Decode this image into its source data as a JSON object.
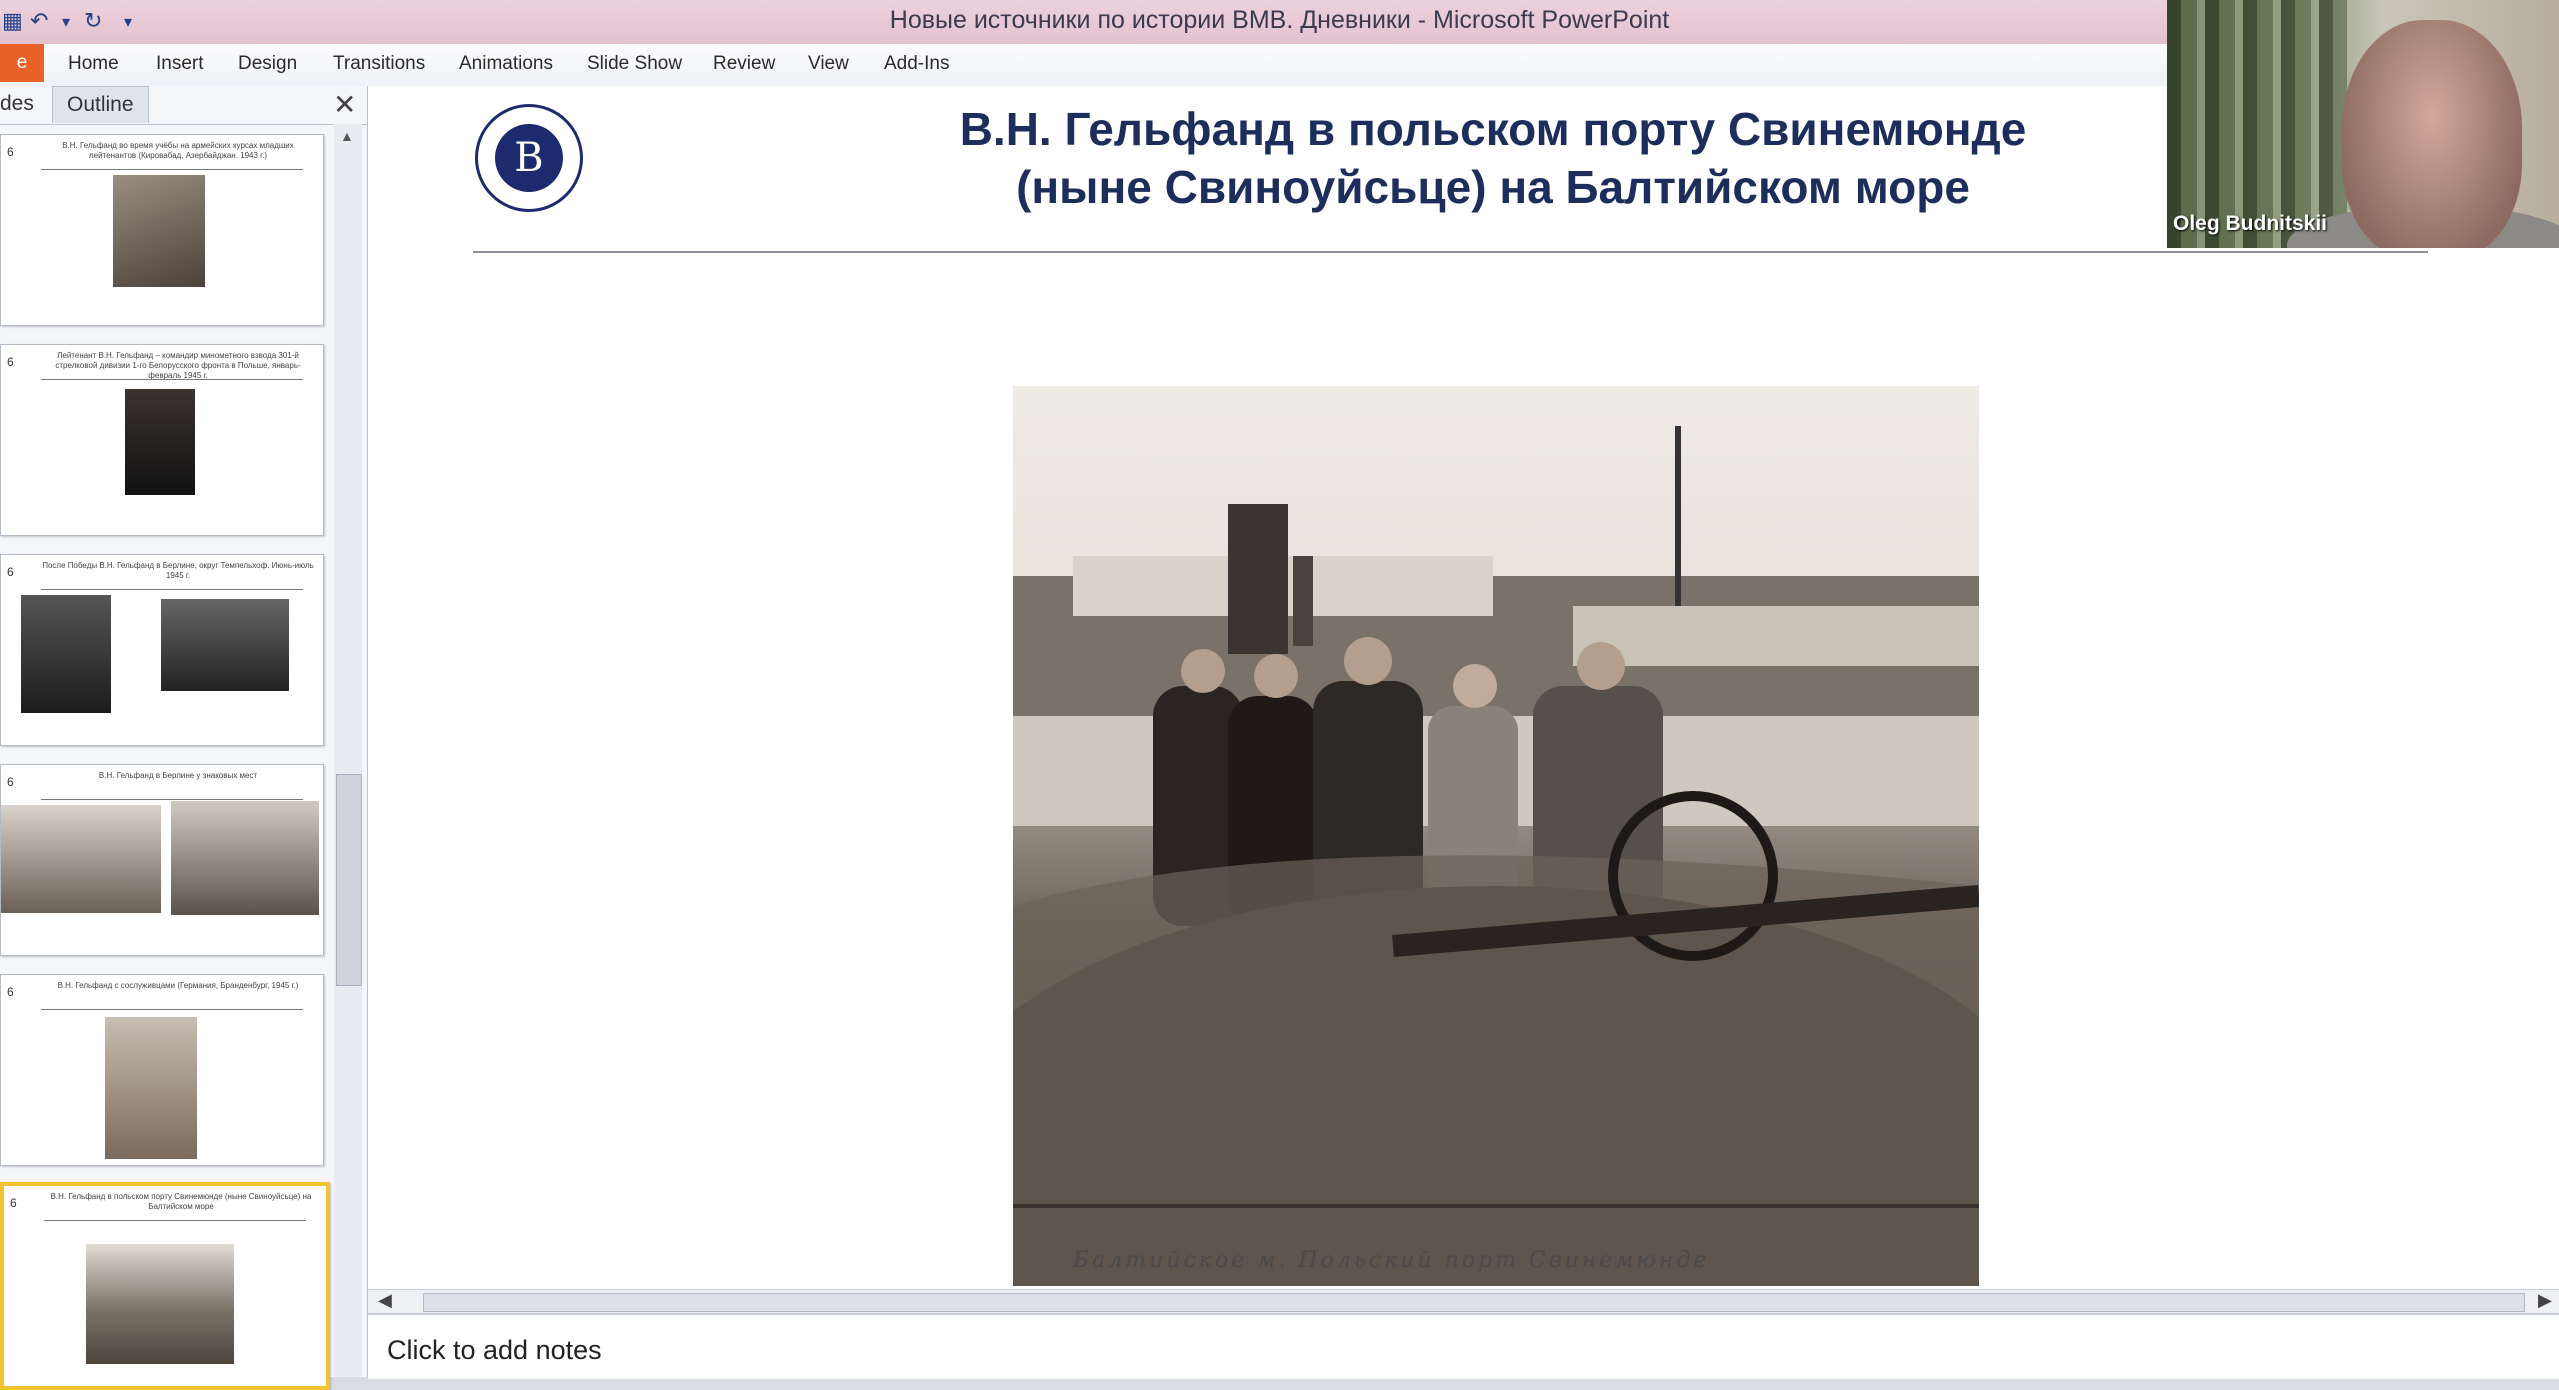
{
  "window": {
    "title": "Новые источники по истории ВМВ. Дневники  -  Microsoft PowerPoint",
    "quick_access": [
      "save-icon",
      "undo-icon",
      "redo-icon",
      "customize-icon"
    ]
  },
  "ribbon": {
    "file_tab": "e",
    "tabs": [
      "Home",
      "Insert",
      "Design",
      "Transitions",
      "Animations",
      "Slide Show",
      "Review",
      "View",
      "Add-Ins"
    ]
  },
  "panel": {
    "tabs": [
      "des",
      "Outline"
    ],
    "close": "✕",
    "thumbnails": [
      {
        "number": "6",
        "caption": "В.Н. Гельфанд во время учёбы на армейских курсах младших лейтенантов (Кировабад, Азербайджан. 1943 г.)"
      },
      {
        "number": "6",
        "caption": "Лейтенант В.Н. Гельфанд – командир минометного взвода 301-й стрелковой дивизии 1-го Белорусского фронта в Польше, январь-февраль 1945 г."
      },
      {
        "number": "6",
        "caption": "После Победы В.Н. Гельфанд в Берлине, округ Темпельхоф. Июнь-июль 1945 г."
      },
      {
        "number": "6",
        "caption": "В.Н. Гельфанд в Берлине у знаковых мест"
      },
      {
        "number": "6",
        "caption": "В.Н. Гельфанд с сослуживцами (Германия, Бранденбург, 1945 г.)"
      },
      {
        "number": "6",
        "caption": "В.Н. Гельфанд в польском порту Свинемюнде (ныне Свиноуйсьце) на Балтийском море"
      }
    ]
  },
  "slide": {
    "title_line1": "В.Н. Гельфанд в польском порту Свинемюнде",
    "title_line2": "(ныне Свиноуйсьце) на Балтийском море",
    "handwritten_caption": "Балтийское м. Польский порт Свинемюнде"
  },
  "notes": {
    "placeholder": "Click to add notes"
  },
  "video": {
    "speaker": "Oleg Budnitskii"
  }
}
